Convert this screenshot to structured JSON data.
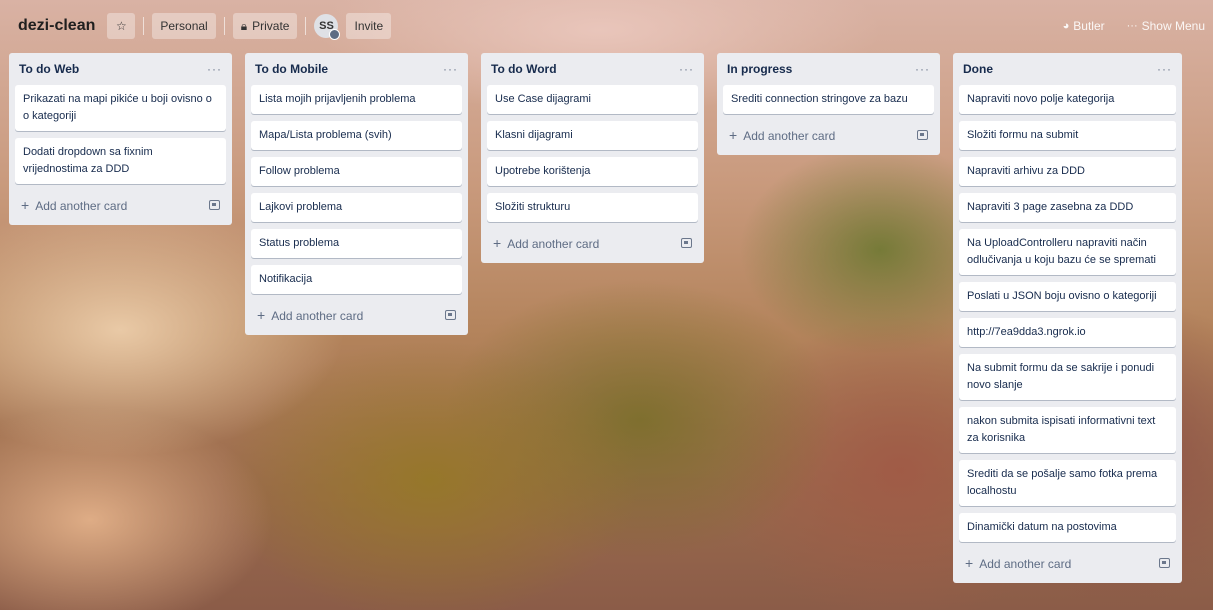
{
  "board": {
    "title": "dezi-clean",
    "star_icon": "star-icon",
    "team_label": "Personal",
    "visibility_label": "Private",
    "member_initials": "SS",
    "invite_label": "Invite"
  },
  "header_right": {
    "butler_label": "Butler",
    "show_menu_label": "Show Menu"
  },
  "lists": [
    {
      "title": "To do Web",
      "cards": [
        "Prikazati na mapi pikiće u boji ovisno o o kategoriji",
        "Dodati dropdown sa fixnim vrijednostima za DDD"
      ],
      "add_label": "Add another card"
    },
    {
      "title": "To do Mobile",
      "cards": [
        "Lista mojih prijavljenih problema",
        "Mapa/Lista problema (svih)",
        "Follow problema",
        "Lajkovi problema",
        "Status problema",
        "Notifikacija"
      ],
      "add_label": "Add another card"
    },
    {
      "title": "To do Word",
      "cards": [
        "Use Case dijagrami",
        "Klasni dijagrami",
        "Upotrebe korištenja",
        "Složiti strukturu"
      ],
      "add_label": "Add another card"
    },
    {
      "title": "In progress",
      "cards": [
        "Srediti connection stringove za bazu"
      ],
      "add_label": "Add another card"
    },
    {
      "title": "Done",
      "cards": [
        "Napraviti novo polje kategorija",
        "Složiti formu na submit",
        "Napraviti arhivu za DDD",
        "Napraviti 3 page zasebna za DDD",
        "Na UploadControlleru napraviti način odlučivanja u koju bazu će se spremati",
        "Poslati u JSON boju ovisno o kategoriji",
        "http://7ea9dda3.ngrok.io",
        "Na submit formu da se sakrije i ponudi novo slanje",
        "nakon submita ispisati informativni text za korisnika",
        "Srediti da se pošalje samo fotka prema localhostu",
        "Dinamički datum na postovima"
      ],
      "add_label": "Add another card"
    }
  ],
  "list_menu_glyph": "···",
  "add_plus_glyph": "+"
}
